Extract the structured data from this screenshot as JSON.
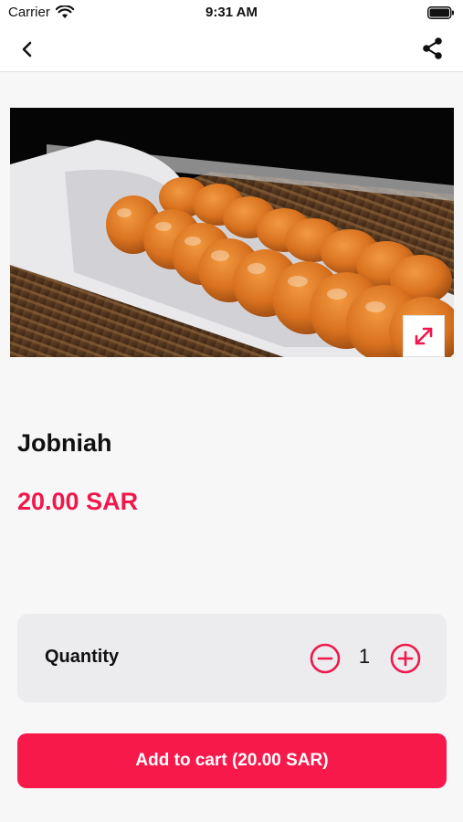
{
  "status_bar": {
    "carrier": "Carrier",
    "time": "9:31 AM",
    "icons": [
      "wifi-icon",
      "battery-icon"
    ]
  },
  "nav": {
    "back_icon": "chevron-left-icon",
    "share_icon": "share-icon"
  },
  "product": {
    "name": "Jobniah",
    "price": "20.00 SAR",
    "image_alt": "Jobniah pastries on a white dish",
    "expand_icon": "expand-icon"
  },
  "quantity": {
    "label": "Quantity",
    "value": "1",
    "minus_icon": "minus-circle-icon",
    "plus_icon": "plus-circle-icon"
  },
  "cart": {
    "button_label": "Add to cart (20.00 SAR)"
  },
  "colors": {
    "accent": "#f8194b",
    "price": "#f0184b",
    "background": "#f7f7f8",
    "card": "#ececef"
  }
}
